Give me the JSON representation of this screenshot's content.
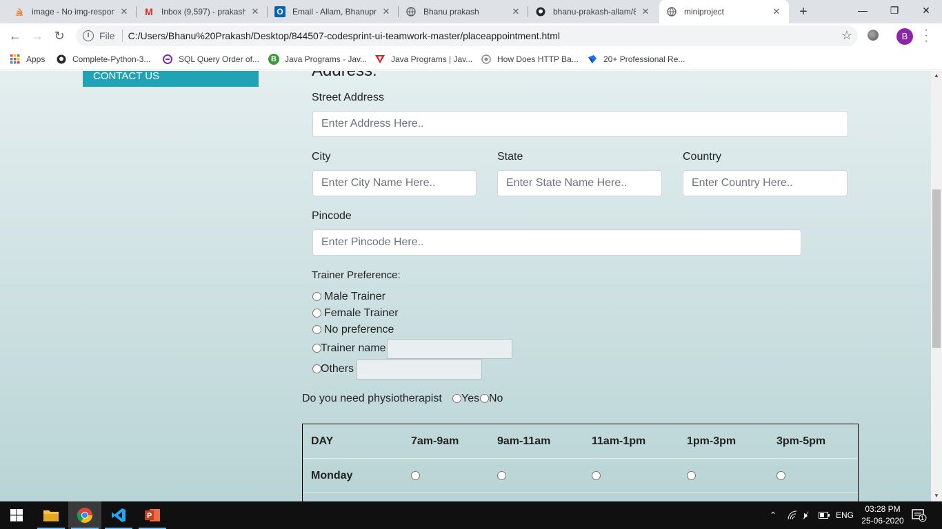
{
  "browser": {
    "tabs": [
      {
        "title": "image - No img-respon",
        "icon": "stack-icon"
      },
      {
        "title": "Inbox (9,597) - prakash",
        "icon": "gmail-icon"
      },
      {
        "title": "Email - Allam, Bhanupra",
        "icon": "outlook-icon"
      },
      {
        "title": "Bhanu prakash",
        "icon": "globe-icon"
      },
      {
        "title": "bhanu-prakash-allam/8",
        "icon": "github-icon"
      },
      {
        "title": "miniproject",
        "icon": "globe-icon",
        "active": true
      }
    ],
    "address": {
      "scheme_label": "File",
      "url": "C:/Users/Bhanu%20Prakash/Desktop/844507-codesprint-ui-teamwork-master/placeappointment.html"
    },
    "profile_initial": "B",
    "bookmarks": [
      {
        "label": "Apps",
        "icon": "apps-grid-icon"
      },
      {
        "label": "Complete-Python-3...",
        "icon": "github-icon"
      },
      {
        "label": "SQL Query Order of...",
        "icon": "sql-icon"
      },
      {
        "label": "Java Programs - Jav...",
        "icon": "java-b-icon"
      },
      {
        "label": "Java Programs | Jav...",
        "icon": "java-v-icon"
      },
      {
        "label": "How Does HTTP Ba...",
        "icon": "http-icon"
      },
      {
        "label": "20+ Professional Re...",
        "icon": "resume-icon"
      }
    ]
  },
  "page": {
    "contact_us": "CONTACT US",
    "address_heading": "Address:",
    "street": {
      "label": "Street Address",
      "placeholder": "Enter Address Here.."
    },
    "city": {
      "label": "City",
      "placeholder": "Enter City Name Here.."
    },
    "state": {
      "label": "State",
      "placeholder": "Enter State Name Here.."
    },
    "country": {
      "label": "Country",
      "placeholder": "Enter Country Here.."
    },
    "pincode": {
      "label": "Pincode",
      "placeholder": "Enter Pincode Here.."
    },
    "trainer": {
      "label": "Trainer Preference:",
      "options": [
        "Male Trainer",
        "Female Trainer",
        "No preference",
        "Trainer name",
        "Others"
      ]
    },
    "physio": {
      "question": "Do you need physiotherapist",
      "yes": "Yes",
      "no": "No"
    },
    "schedule": {
      "headers": [
        "DAY",
        "7am-9am",
        "9am-11am",
        "11am-1pm",
        "1pm-3pm",
        "3pm-5pm"
      ],
      "rows": [
        {
          "day": "Monday"
        }
      ]
    }
  },
  "taskbar": {
    "apps": [
      "windows-start-icon",
      "file-explorer-icon",
      "chrome-icon",
      "vscode-icon",
      "powerpoint-icon"
    ],
    "language": "ENG",
    "time": "03:28 PM",
    "date": "25-06-2020",
    "notification_count": "1"
  }
}
